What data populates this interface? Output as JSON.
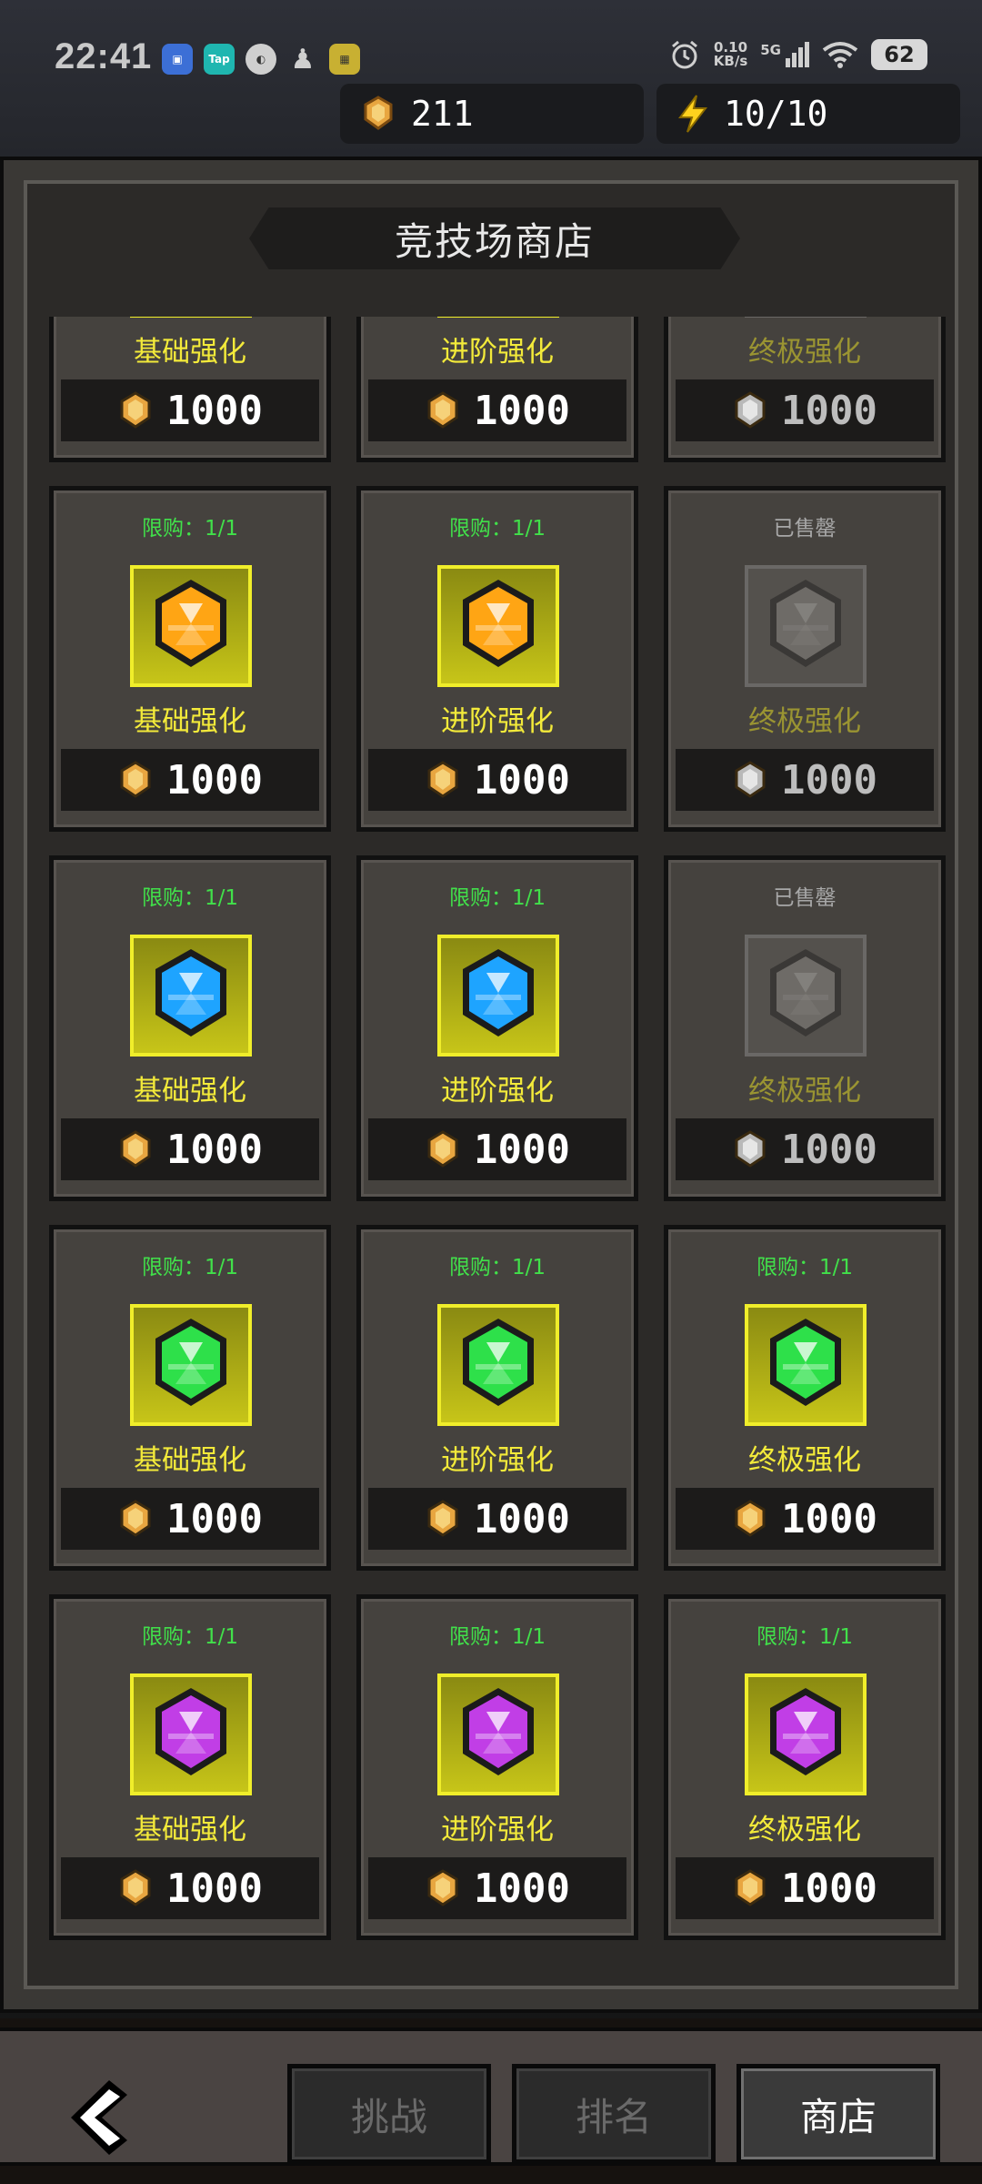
{
  "status_bar": {
    "time": "22:41",
    "net_speed_value": "0.10",
    "net_speed_unit": "KB/s",
    "signal": "5G",
    "battery": "62",
    "apps": [
      "app-icon-1",
      "Tap",
      "app-icon-3",
      "qq-icon",
      "app-icon-5"
    ]
  },
  "currency": {
    "trophies": "211",
    "energy": "10/10"
  },
  "shop": {
    "title": "竞技场商店"
  },
  "items": [
    {
      "limit": "",
      "name": "基础强化",
      "price": "1000",
      "gem": "#ff2f86",
      "sold": false
    },
    {
      "limit": "",
      "name": "进阶强化",
      "price": "1000",
      "gem": "#ff2f86",
      "sold": false
    },
    {
      "limit": "",
      "name": "终极强化",
      "price": "1000",
      "gem": "#ff2f86",
      "sold": true
    },
    {
      "limit": "限购：1/1",
      "name": "基础强化",
      "price": "1000",
      "gem": "#ffa514",
      "sold": false
    },
    {
      "limit": "限购：1/1",
      "name": "进阶强化",
      "price": "1000",
      "gem": "#ffa514",
      "sold": false
    },
    {
      "limit": "已售罄",
      "name": "终极强化",
      "price": "1000",
      "gem": "#ffa514",
      "sold": true
    },
    {
      "limit": "限购：1/1",
      "name": "基础强化",
      "price": "1000",
      "gem": "#1ea4ff",
      "sold": false
    },
    {
      "limit": "限购：1/1",
      "name": "进阶强化",
      "price": "1000",
      "gem": "#1ea4ff",
      "sold": false
    },
    {
      "limit": "已售罄",
      "name": "终极强化",
      "price": "1000",
      "gem": "#1ea4ff",
      "sold": true
    },
    {
      "limit": "限购：1/1",
      "name": "基础强化",
      "price": "1000",
      "gem": "#2ee04a",
      "sold": false
    },
    {
      "limit": "限购：1/1",
      "name": "进阶强化",
      "price": "1000",
      "gem": "#2ee04a",
      "sold": false
    },
    {
      "limit": "限购：1/1",
      "name": "终极强化",
      "price": "1000",
      "gem": "#2ee04a",
      "sold": false
    },
    {
      "limit": "限购：1/1",
      "name": "基础强化",
      "price": "1000",
      "gem": "#c13ee6",
      "sold": false
    },
    {
      "limit": "限购：1/1",
      "name": "进阶强化",
      "price": "1000",
      "gem": "#c13ee6",
      "sold": false
    },
    {
      "limit": "限购：1/1",
      "name": "终极强化",
      "price": "1000",
      "gem": "#c13ee6",
      "sold": false
    }
  ],
  "nav": {
    "challenge": "挑战",
    "ranking": "排名",
    "shop": "商店",
    "active": "shop"
  },
  "colors": {
    "limit_text": "#41e04a",
    "name_text": "#f3ea3a",
    "frame_border": "#f0ee2a",
    "coin": "#e8a640"
  }
}
